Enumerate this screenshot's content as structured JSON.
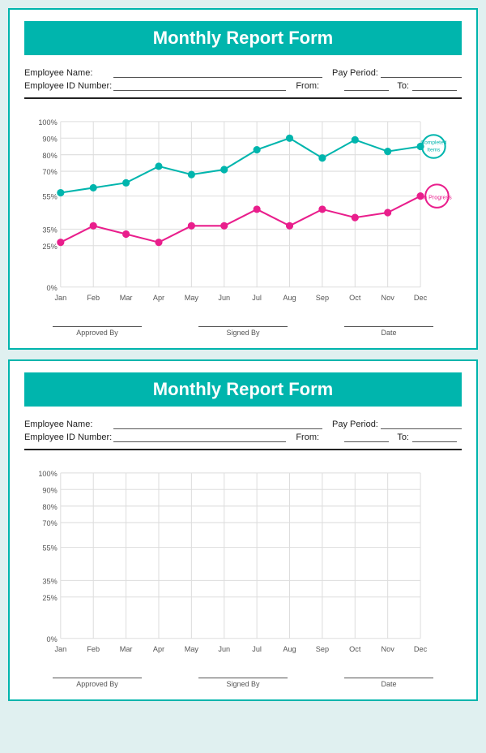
{
  "cards": [
    {
      "title": "Monthly Report Form",
      "fields": {
        "employee_name_label": "Employee Name:",
        "pay_period_label": "Pay Period:",
        "employee_id_label": "Employee ID Number:",
        "from_label": "From:",
        "to_label": "To:"
      },
      "chart": {
        "months": [
          "Jan",
          "Feb",
          "Mar",
          "Apr",
          "May",
          "Jun",
          "Jul",
          "Aug",
          "Sep",
          "Oct",
          "Nov",
          "Dec"
        ],
        "y_labels": [
          "100%",
          "90%",
          "80%",
          "70%",
          "55%",
          "35%",
          "25%",
          "0%"
        ],
        "completed": [
          57,
          60,
          63,
          73,
          68,
          71,
          83,
          90,
          78,
          89,
          82,
          85
        ],
        "in_progress": [
          27,
          37,
          32,
          27,
          37,
          37,
          47,
          37,
          47,
          42,
          45,
          55
        ],
        "legend_completed": "Completed Items",
        "legend_in_progress": "In Progress"
      },
      "signatures": {
        "approved_by": "Approved By",
        "signed_by": "Signed By",
        "date": "Date"
      }
    },
    {
      "title": "Monthly Report Form",
      "fields": {
        "employee_name_label": "Employee Name:",
        "pay_period_label": "Pay Period:",
        "employee_id_label": "Employee ID Number:",
        "from_label": "From:",
        "to_label": "To:"
      },
      "chart": {
        "months": [
          "Jan",
          "Feb",
          "Mar",
          "Apr",
          "May",
          "Jun",
          "Jul",
          "Aug",
          "Sep",
          "Oct",
          "Nov",
          "Dec"
        ],
        "y_labels": [
          "100%",
          "90%",
          "80%",
          "70%",
          "55%",
          "35%",
          "25%",
          "0%"
        ],
        "completed": [],
        "in_progress": []
      },
      "signatures": {
        "approved_by": "Approved By",
        "signed_by": "Signed By",
        "date": "Date"
      }
    }
  ]
}
